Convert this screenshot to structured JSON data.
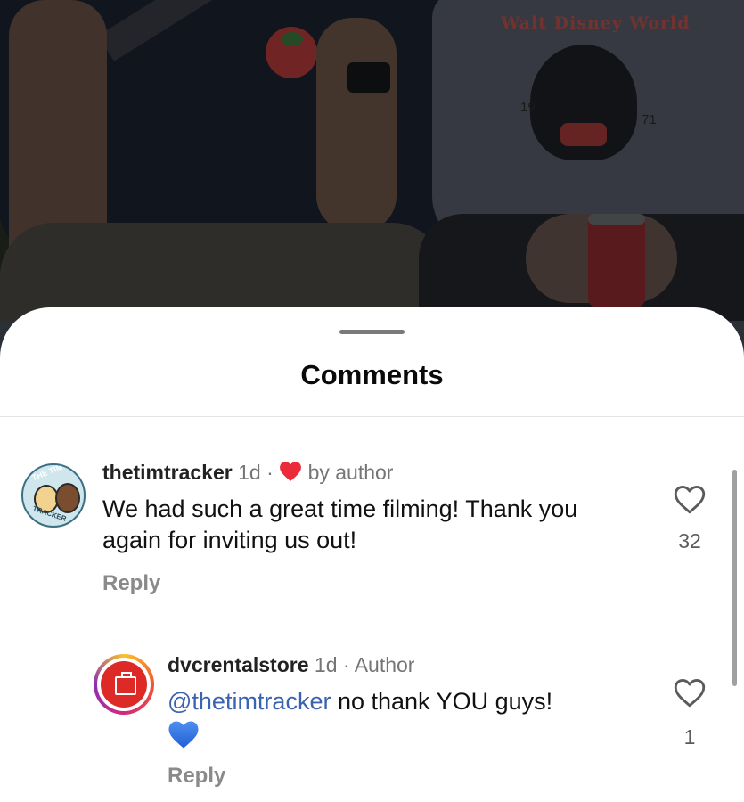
{
  "background_photo": {
    "sweater_text": "Walt Disney World",
    "sweater_year_left": "19",
    "sweater_year_right": "71"
  },
  "sheet": {
    "title": "Comments"
  },
  "comments": [
    {
      "username": "thetimtracker",
      "age": "1d",
      "separator": "·",
      "liked_by_author_label": "by author",
      "text": "We had such a great time filming! Thank you again for inviting us out!",
      "reply_label": "Reply",
      "like_count": "32",
      "avatar_icon": "tim-tracker-logo-avatar",
      "avatar_ring_top": "THE TIM",
      "avatar_ring_bottom": "TRACKER"
    },
    {
      "username": "dvcrentalstore",
      "age": "1d",
      "separator": "·",
      "author_badge": "Author",
      "mention": "@thetimtracker",
      "text": "no thank YOU guys!",
      "emoji": "blue-heart",
      "reply_label": "Reply",
      "like_count": "1",
      "avatar_icon": "dvc-rental-store-logo-avatar"
    }
  ],
  "colors": {
    "author_heart": "#ec2b3a",
    "mention": "#3b63b2",
    "blue_heart": "#2f6fe0"
  }
}
